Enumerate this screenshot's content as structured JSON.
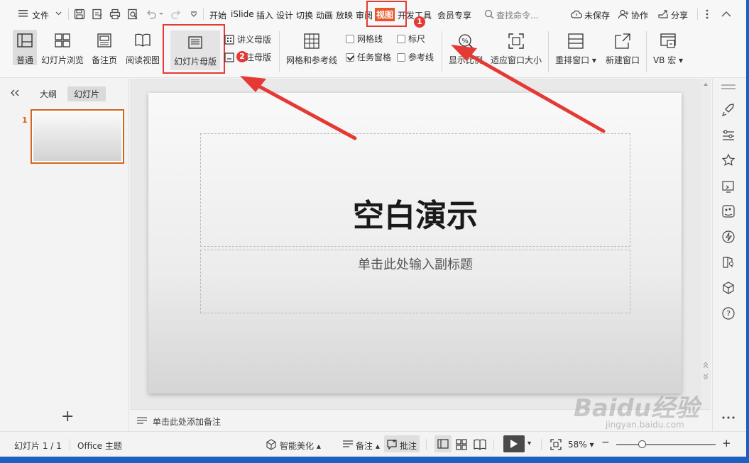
{
  "menubar": {
    "file_label": "文件",
    "tabs": [
      "开始",
      "iSlide",
      "插入",
      "设计",
      "切换",
      "动画",
      "放映",
      "审阅",
      "视图",
      "开发工具",
      "会员专享"
    ],
    "active_tab": "视图",
    "search_placeholder": "查找命令...",
    "unsaved_label": "未保存",
    "collab_label": "协作",
    "share_label": "分享"
  },
  "ribbon": {
    "normal": "普通",
    "slide_browse": "幻灯片浏览",
    "notes_page": "备注页",
    "reading_view": "阅读视图",
    "slide_master": "幻灯片母版",
    "handout_master": "讲义母版",
    "notes_master": "备注母版",
    "grid_guides": "网格和参考线",
    "gridlines": "网格线",
    "ruler": "标尺",
    "task_pane": "任务窗格",
    "guides": "参考线",
    "zoom": "显示比例",
    "fit_window": "适应窗口大小",
    "rearrange": "重排窗口",
    "new_window": "新建窗口",
    "vb_macro": "VB 宏"
  },
  "annotations": {
    "badge1": "1",
    "badge2": "2",
    "accent": "#e53935"
  },
  "leftpanel": {
    "tab_outline": "大纲",
    "tab_slides": "幻灯片",
    "slide_number": "1",
    "add": "+"
  },
  "slide": {
    "title": "空白演示",
    "subtitle": "单击此处输入副标题"
  },
  "notes": {
    "placeholder": "单击此处添加备注"
  },
  "status": {
    "slide_counter": "幻灯片 1 / 1",
    "theme": "Office 主题",
    "smart_beautify": "智能美化",
    "notes": "备注",
    "comments": "批注",
    "zoom": "58%"
  },
  "watermark": {
    "text": "Baidu经验",
    "url": "jingyan.baidu.com"
  }
}
